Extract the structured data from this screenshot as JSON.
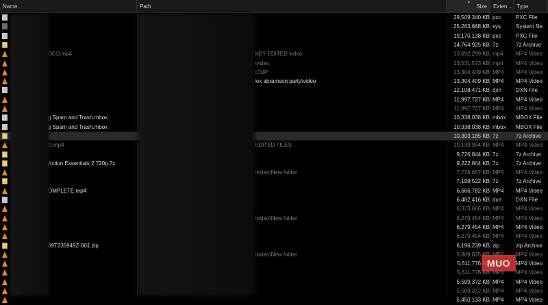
{
  "columns": {
    "name": "Name",
    "path": "Path",
    "size": "Size",
    "extension": "Exten...",
    "type": "Type"
  },
  "rows": [
    {
      "icon": "document-icon",
      "name": "",
      "path": "",
      "size": "29,509,340 KB",
      "ext": "pxc",
      "type": "PXC File",
      "dim": false,
      "selected": false
    },
    {
      "icon": "document-dark-icon",
      "name": "",
      "path": "",
      "size": "25,263,668 KB",
      "ext": "sys",
      "type": "System file",
      "dim": false,
      "selected": false
    },
    {
      "icon": "document-icon",
      "name": "",
      "path": "",
      "size": "19,170,138 KB",
      "ext": "pxc",
      "type": "PXC File",
      "dim": false,
      "selected": false
    },
    {
      "icon": "archive-icon",
      "name": "",
      "path": "",
      "size": "14,764,925 KB",
      "ext": "7z",
      "type": "7z Archive",
      "dim": false,
      "selected": false
    },
    {
      "icon": "vlc-icon",
      "name": "DEO.mp4",
      "path": "NEY EDITED video",
      "size": "13,692,299 KB",
      "ext": "mp4",
      "type": "MP4 Video",
      "dim": true,
      "selected": false
    },
    {
      "icon": "vlc-icon",
      "name": "",
      "path": "\\video",
      "size": "13,531,573 KB",
      "ext": "mp4",
      "type": "MP4 Video",
      "dim": true,
      "selected": false
    },
    {
      "icon": "vlc-icon",
      "name": "",
      "path": "\\CUP",
      "size": "13,304,409 KB",
      "ext": "MP4",
      "type": "MP4 Video",
      "dim": true,
      "selected": false
    },
    {
      "icon": "vlc-icon",
      "name": "",
      "path": "lex abramson party\\video",
      "size": "13,304,409 KB",
      "ext": "MP4",
      "type": "MP4 Video",
      "dim": false,
      "selected": false
    },
    {
      "icon": "document-icon",
      "name": "",
      "path": "",
      "size": "12,108,471 KB",
      "ext": "dxn",
      "type": "DXN File",
      "dim": false,
      "selected": false
    },
    {
      "icon": "vlc-icon",
      "name": "",
      "path": "",
      "size": "11,997,727 KB",
      "ext": "MP4",
      "type": "MP4 Video",
      "dim": false,
      "selected": false
    },
    {
      "icon": "vlc-icon",
      "name": "",
      "path": "",
      "size": "11,997,727 KB",
      "ext": "MP4",
      "type": "MP4 Video",
      "dim": true,
      "selected": false
    },
    {
      "icon": "document-icon",
      "name": "g Spam and Trash.mbox",
      "path": "",
      "size": "10,338,038 KB",
      "ext": "mbox",
      "type": "MBOX File",
      "dim": false,
      "selected": false
    },
    {
      "icon": "document-icon",
      "name": "g Spam and Trash.mbox",
      "path": "",
      "size": "10,338,038 KB",
      "ext": "mbox",
      "type": "MBOX File",
      "dim": false,
      "selected": false
    },
    {
      "icon": "archive-icon",
      "name": "",
      "path": "",
      "size": "10,303,185 KB",
      "ext": "7z",
      "type": "7z Archive",
      "dim": false,
      "selected": true
    },
    {
      "icon": "vlc-icon",
      "name": "D.mp4",
      "path": "EDITED FILES",
      "size": "10,139,904 KB",
      "ext": "MP4",
      "type": "MP4 Video",
      "dim": true,
      "selected": false
    },
    {
      "icon": "archive-icon",
      "name": "",
      "path": "",
      "size": "9,726,844 KB",
      "ext": "7z",
      "type": "7z Archive",
      "dim": false,
      "selected": false
    },
    {
      "icon": "archive-icon",
      "name": "Action Essentials 2 720p.7z",
      "path": "",
      "size": "9,222,804 KB",
      "ext": "7z",
      "type": "7z Archive",
      "dim": false,
      "selected": false
    },
    {
      "icon": "vlc-icon",
      "name": "",
      "path": "\\video\\New folder",
      "size": "7,778,657 KB",
      "ext": "MP4",
      "type": "MP4 Video",
      "dim": true,
      "selected": false
    },
    {
      "icon": "archive-icon",
      "name": "",
      "path": "",
      "size": "7,199,522 KB",
      "ext": "7z",
      "type": "7z Archive",
      "dim": false,
      "selected": false
    },
    {
      "icon": "vlc-icon",
      "name": "OMPLETE.mp4",
      "path": "",
      "size": "6,666,782 KB",
      "ext": "MP4",
      "type": "MP4 Video",
      "dim": false,
      "selected": false
    },
    {
      "icon": "document-icon",
      "name": "",
      "path": "",
      "size": "6,482,416 KB",
      "ext": "dxn",
      "type": "DXN File",
      "dim": false,
      "selected": false
    },
    {
      "icon": "vlc-icon",
      "name": "",
      "path": "",
      "size": "6,373,666 KB",
      "ext": "MP4",
      "type": "MP4 Video",
      "dim": true,
      "selected": false
    },
    {
      "icon": "vlc-icon",
      "name": "",
      "path": "\\video\\New folder",
      "size": "6,279,454 KB",
      "ext": "MP4",
      "type": "MP4 Video",
      "dim": true,
      "selected": false
    },
    {
      "icon": "vlc-icon",
      "name": "",
      "path": "",
      "size": "6,279,454 KB",
      "ext": "MP4",
      "type": "MP4 Video",
      "dim": false,
      "selected": false
    },
    {
      "icon": "vlc-icon",
      "name": "",
      "path": "",
      "size": "6,279,454 KB",
      "ext": "MP4",
      "type": "MP4 Video",
      "dim": true,
      "selected": false
    },
    {
      "icon": "archive-icon",
      "name": "09T235949Z-001.zip",
      "path": "",
      "size": "6,196,239 KB",
      "ext": "zip",
      "type": "zip Archive",
      "dim": false,
      "selected": false
    },
    {
      "icon": "vlc-icon",
      "name": "",
      "path": "\\video\\New folder",
      "size": "5,869,835 KB",
      "ext": "MP4",
      "type": "MP4 Video",
      "dim": true,
      "selected": false
    },
    {
      "icon": "vlc-icon",
      "name": "",
      "path": "",
      "size": "5,611,776 KB",
      "ext": "MP4",
      "type": "MP4 Video",
      "dim": false,
      "selected": false
    },
    {
      "icon": "vlc-icon",
      "name": "",
      "path": "",
      "size": "5,611,776 KB",
      "ext": "MP4",
      "type": "MP4 Video",
      "dim": true,
      "selected": false
    },
    {
      "icon": "vlc-icon",
      "name": "",
      "path": "",
      "size": "5,509,372 KB",
      "ext": "MP4",
      "type": "MP4 Video",
      "dim": false,
      "selected": false
    },
    {
      "icon": "vlc-icon",
      "name": "",
      "path": "",
      "size": "5,509,372 KB",
      "ext": "MP4",
      "type": "MP4 Video",
      "dim": true,
      "selected": false
    },
    {
      "icon": "vlc-icon",
      "name": "",
      "path": "",
      "size": "5,450,133 KB",
      "ext": "MP4",
      "type": "MP4 Video",
      "dim": false,
      "selected": false
    }
  ],
  "watermark": "MUO"
}
